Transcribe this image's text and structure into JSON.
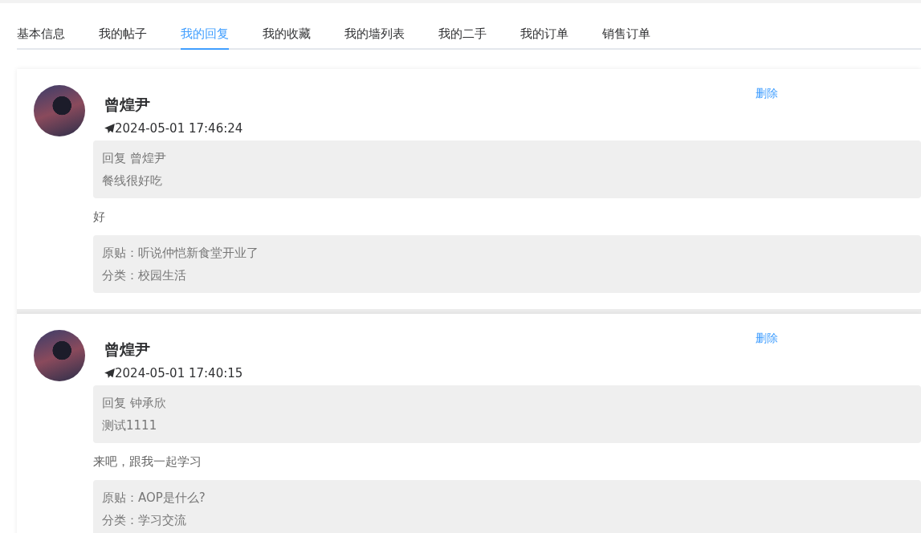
{
  "tabs": [
    {
      "label": "基本信息",
      "selected": false
    },
    {
      "label": "我的帖子",
      "selected": false
    },
    {
      "label": "我的回复",
      "selected": true
    },
    {
      "label": "我的收藏",
      "selected": false
    },
    {
      "label": "我的墙列表",
      "selected": false
    },
    {
      "label": "我的二手",
      "selected": false
    },
    {
      "label": "我的订单",
      "selected": false
    },
    {
      "label": "销售订单",
      "selected": false
    }
  ],
  "replies": [
    {
      "author": "曾煌尹",
      "time": "2024-05-01 17:46:24",
      "delete": "删除",
      "reply_to": "回复 曾煌尹",
      "quoted": "餐线很好吃",
      "content": "好",
      "original_post": "原贴：听说仲恺新食堂开业了",
      "category": "分类：校园生活"
    },
    {
      "author": "曾煌尹",
      "time": "2024-05-01 17:40:15",
      "delete": "删除",
      "reply_to": "回复 钟承欣",
      "quoted": "测试1111",
      "content": "来吧，跟我一起学习",
      "original_post": "原贴：AOP是什么?",
      "category": "分类：学习交流"
    }
  ]
}
